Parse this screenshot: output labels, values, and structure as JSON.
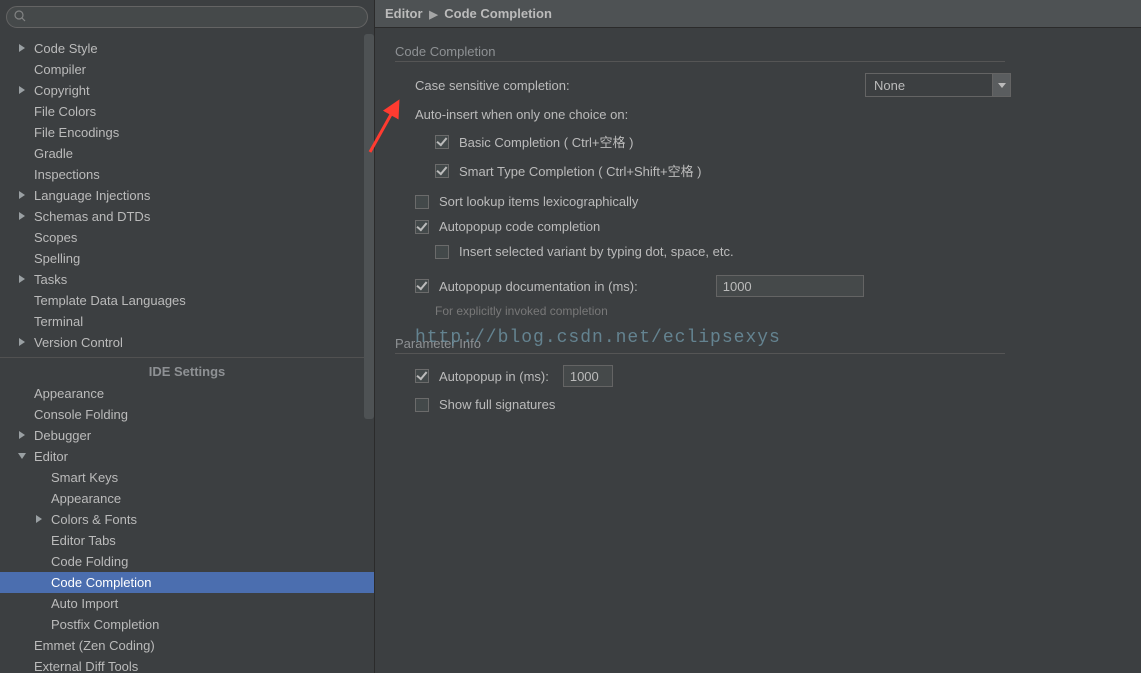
{
  "search": {
    "placeholder": ""
  },
  "tree": {
    "items": [
      {
        "label": "Code Style",
        "level": 0,
        "arrow": "right"
      },
      {
        "label": "Compiler",
        "level": 0,
        "arrow": ""
      },
      {
        "label": "Copyright",
        "level": 0,
        "arrow": "right"
      },
      {
        "label": "File Colors",
        "level": 0,
        "arrow": ""
      },
      {
        "label": "File Encodings",
        "level": 0,
        "arrow": ""
      },
      {
        "label": "Gradle",
        "level": 0,
        "arrow": ""
      },
      {
        "label": "Inspections",
        "level": 0,
        "arrow": ""
      },
      {
        "label": "Language Injections",
        "level": 0,
        "arrow": "right"
      },
      {
        "label": "Schemas and DTDs",
        "level": 0,
        "arrow": "right"
      },
      {
        "label": "Scopes",
        "level": 0,
        "arrow": ""
      },
      {
        "label": "Spelling",
        "level": 0,
        "arrow": ""
      },
      {
        "label": "Tasks",
        "level": 0,
        "arrow": "right"
      },
      {
        "label": "Template Data Languages",
        "level": 0,
        "arrow": ""
      },
      {
        "label": "Terminal",
        "level": 0,
        "arrow": ""
      },
      {
        "label": "Version Control",
        "level": 0,
        "arrow": "right"
      }
    ],
    "ide_header": "IDE Settings",
    "ide_items": [
      {
        "label": "Appearance",
        "level": 0,
        "arrow": ""
      },
      {
        "label": "Console Folding",
        "level": 0,
        "arrow": ""
      },
      {
        "label": "Debugger",
        "level": 0,
        "arrow": "right"
      },
      {
        "label": "Editor",
        "level": 0,
        "arrow": "down"
      },
      {
        "label": "Smart Keys",
        "level": 1,
        "arrow": ""
      },
      {
        "label": "Appearance",
        "level": 1,
        "arrow": ""
      },
      {
        "label": "Colors & Fonts",
        "level": 1,
        "arrow": "right"
      },
      {
        "label": "Editor Tabs",
        "level": 1,
        "arrow": ""
      },
      {
        "label": "Code Folding",
        "level": 1,
        "arrow": ""
      },
      {
        "label": "Code Completion",
        "level": 1,
        "arrow": "",
        "selected": true
      },
      {
        "label": "Auto Import",
        "level": 1,
        "arrow": ""
      },
      {
        "label": "Postfix Completion",
        "level": 1,
        "arrow": ""
      },
      {
        "label": "Emmet (Zen Coding)",
        "level": 0,
        "arrow": ""
      },
      {
        "label": "External Diff Tools",
        "level": 0,
        "arrow": ""
      }
    ]
  },
  "breadcrumb": {
    "root": "Editor",
    "leaf": "Code Completion"
  },
  "panel": {
    "section1_title": "Code Completion",
    "case_sensitive_label": "Case sensitive completion:",
    "case_sensitive_value": "None",
    "auto_insert_label": "Auto-insert when only one choice on:",
    "basic_label": "Basic Completion ( Ctrl+空格 )",
    "smart_label": "Smart Type Completion ( Ctrl+Shift+空格 )",
    "sort_label": "Sort lookup items lexicographically",
    "autopopup_code_label": "Autopopup code completion",
    "insert_variant_label": "Insert selected variant by typing dot, space, etc.",
    "autopopup_doc_label": "Autopopup documentation in (ms):",
    "autopopup_doc_value": "1000",
    "autopopup_doc_hint": "For explicitly invoked completion",
    "section2_title": "Parameter Info",
    "autopopup_ms_label": "Autopopup in (ms):",
    "autopopup_ms_value": "1000",
    "show_full_label": "Show full signatures",
    "checkboxes": {
      "basic": true,
      "smart": true,
      "sort": false,
      "autopopup_code": true,
      "insert_variant": false,
      "autopopup_doc": true,
      "autopopup_ms": true,
      "show_full": false
    }
  },
  "watermark": "http://blog.csdn.net/eclipsexys"
}
